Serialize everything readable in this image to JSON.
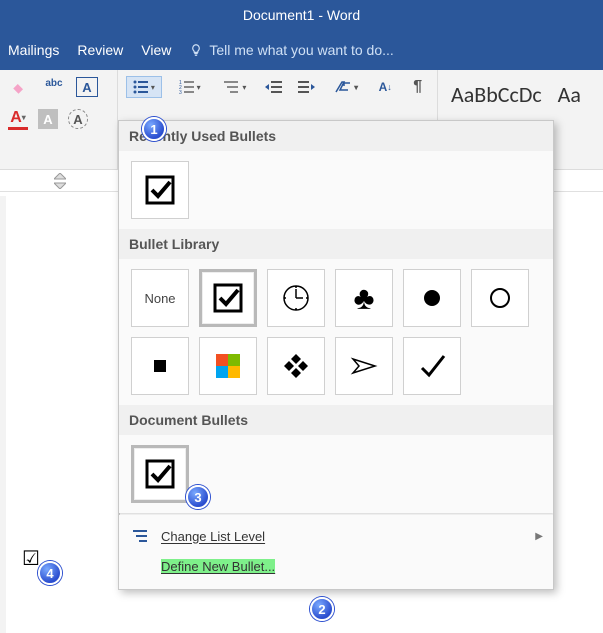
{
  "title": "Document1 - Word",
  "tabs": {
    "mailings": "Mailings",
    "review": "Review",
    "view": "View",
    "tellme": "Tell me what you want to do..."
  },
  "styles": {
    "sample1": "AaBbCcDc",
    "sample2": "Aa"
  },
  "dropdown": {
    "recent_header": "Recently Used Bullets",
    "library_header": "Bullet Library",
    "doc_header": "Document Bullets",
    "none_label": "None",
    "change_list_level": "Change List Level",
    "define_new_bullet": "Define New Bullet..."
  },
  "badges": {
    "b1": "1",
    "b2": "2",
    "b3": "3",
    "b4": "4"
  }
}
